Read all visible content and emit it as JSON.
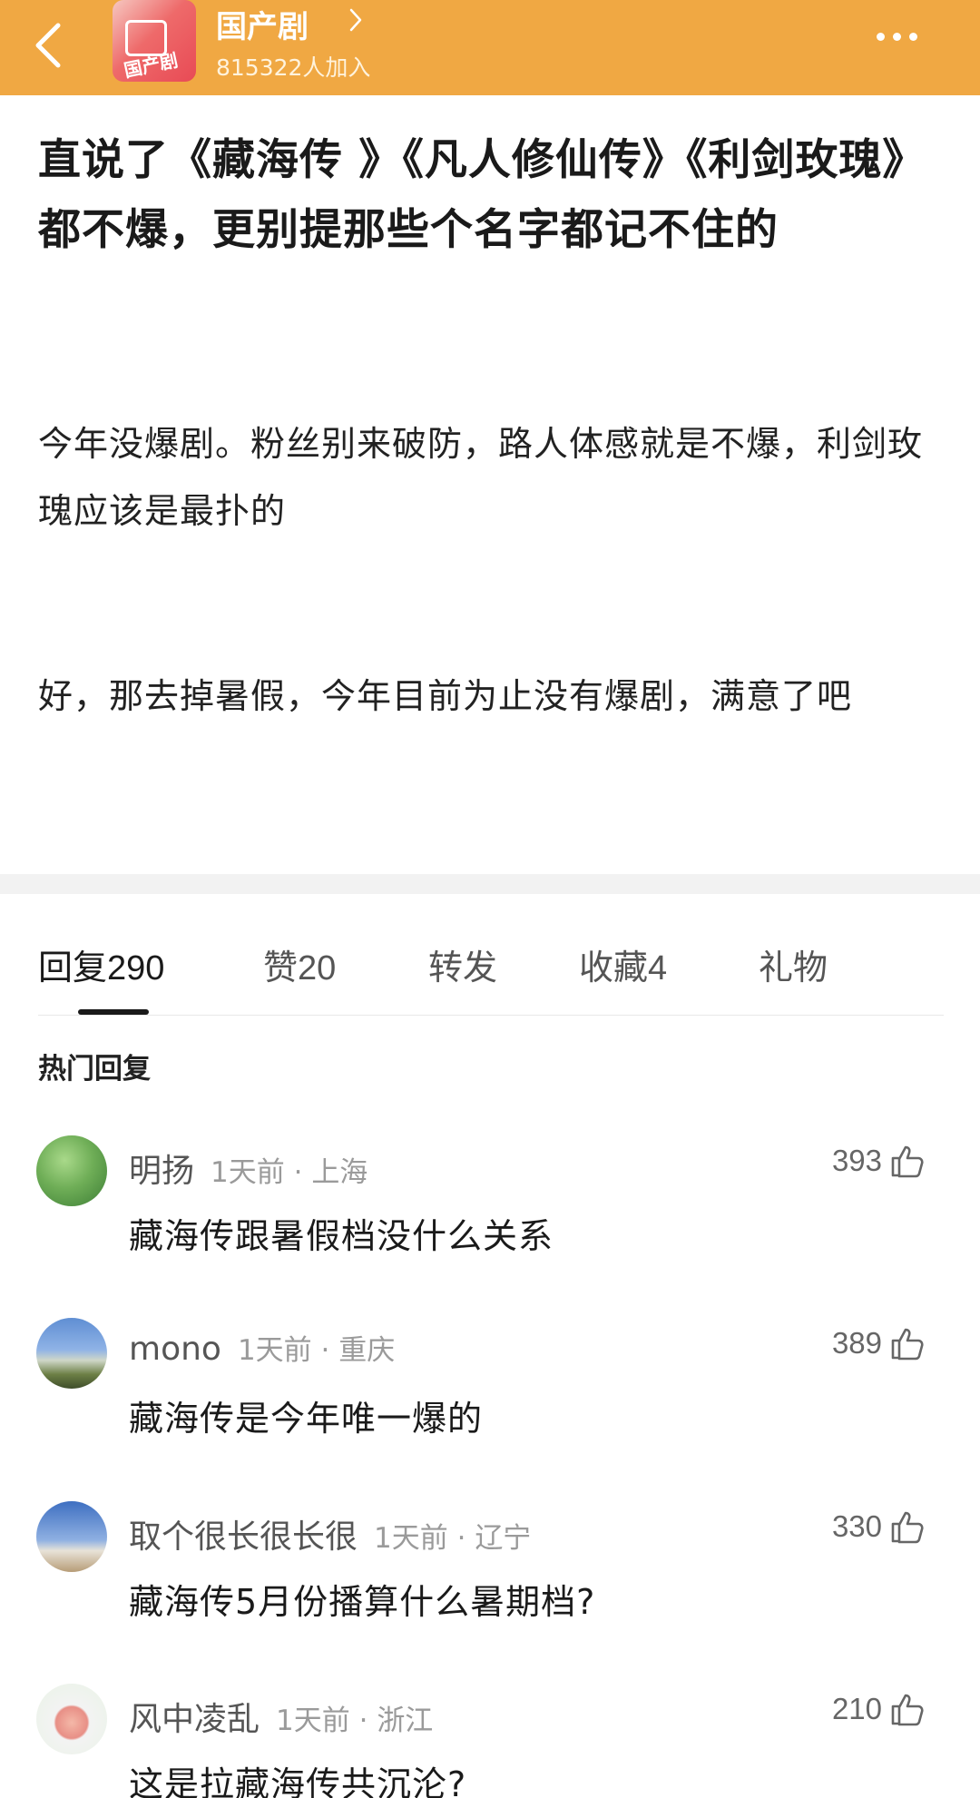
{
  "header": {
    "group_name": "国产剧",
    "members": "815322人加入",
    "avatar_text": "国产剧"
  },
  "post": {
    "title": "直说了《藏海传 》《凡人修仙传》《利剑玫瑰》都不爆，更别提那些个名字都记不住的",
    "paragraphs": [
      "今年没爆剧。粉丝别来破防，路人体感就是不爆，利剑玫瑰应该是最扑的",
      "好，那去掉暑假，今年目前为止没有爆剧，满意了吧"
    ]
  },
  "tabs": [
    {
      "label": "回复",
      "count": "290"
    },
    {
      "label": "赞",
      "count": "20"
    },
    {
      "label": "转发",
      "count": ""
    },
    {
      "label": "收藏",
      "count": "4"
    },
    {
      "label": "礼物",
      "count": ""
    }
  ],
  "hot_heading": "热门回复",
  "comments": [
    {
      "name": "明扬",
      "time": "1天前",
      "location": "上海",
      "text": "藏海传跟暑假档没什么关系",
      "likes": "393"
    },
    {
      "name": "mono",
      "time": "1天前",
      "location": "重庆",
      "text": "藏海传是今年唯一爆的",
      "likes": "389"
    },
    {
      "name": "取个很长很长很",
      "time": "1天前",
      "location": "辽宁",
      "text": "藏海传5月份播算什么暑期档?",
      "likes": "330"
    },
    {
      "name": "风中凌乱",
      "time": "1天前",
      "location": "浙江",
      "text": "这是拉藏海传共沉沦?",
      "likes": "210"
    }
  ],
  "icons": {
    "back": "chevron-left-icon",
    "more": "more-horizontal-icon",
    "like": "thumbs-up-icon"
  },
  "colors": {
    "header_bg": "#f0a843",
    "text_primary": "#1a1a1a",
    "text_meta": "#9a9a9a"
  }
}
